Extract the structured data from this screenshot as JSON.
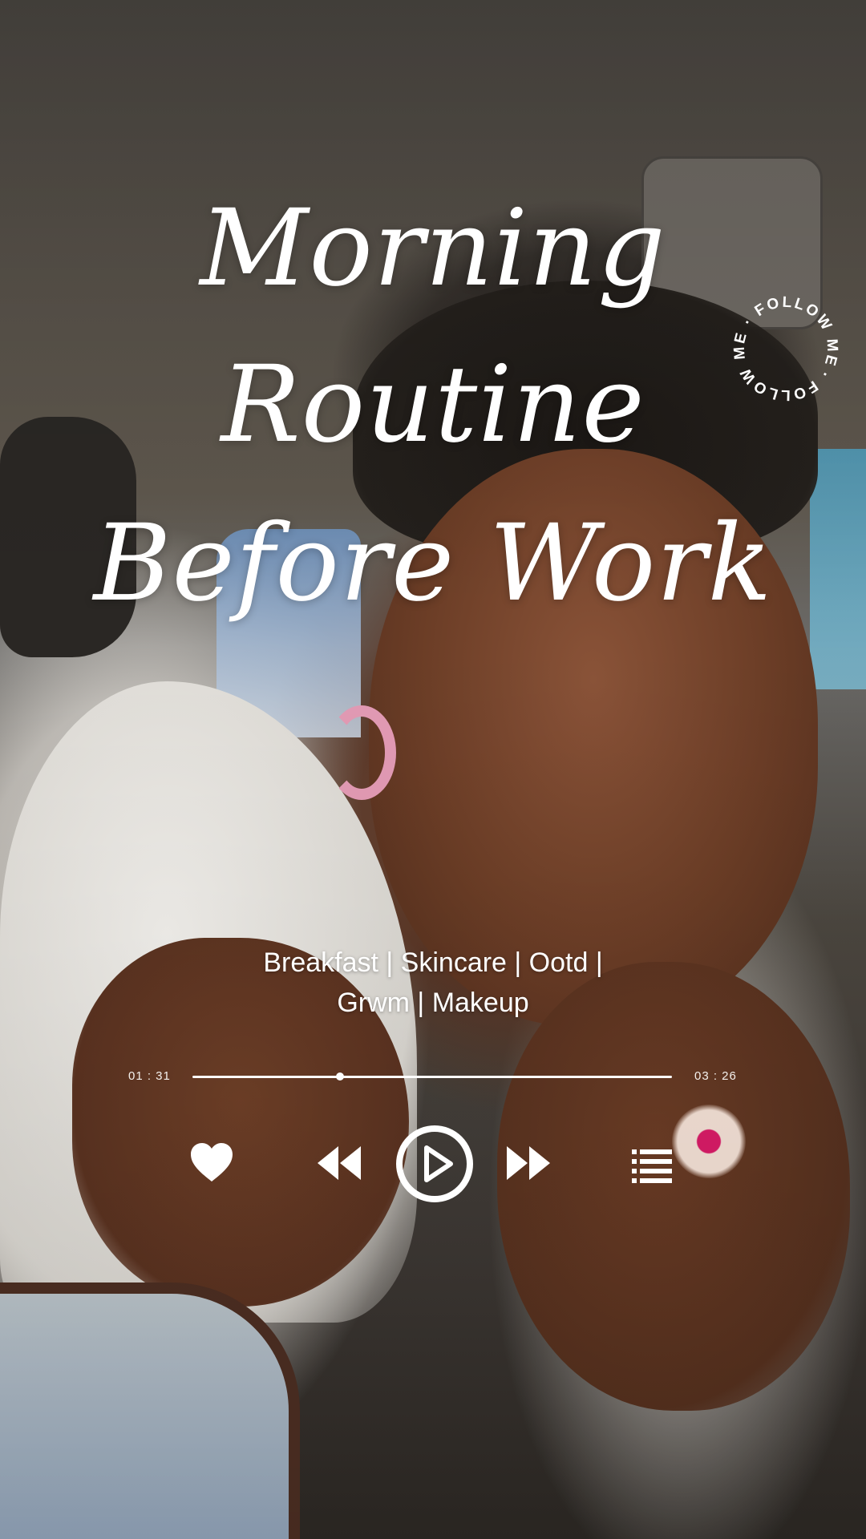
{
  "title": {
    "line1": "Morning",
    "line2": "Routine",
    "line3": "Before Work"
  },
  "badge": {
    "text": "· FOLLOW ME · FOLLOW ME "
  },
  "tags": {
    "line1": "Breakfast | Skincare | Ootd |",
    "line2": "Grwm | Makeup"
  },
  "player": {
    "current_time": "01 : 31",
    "total_time": "03 : 26",
    "progress_fraction": 0.307,
    "controls": {
      "like_icon": "heart-icon",
      "rewind_icon": "rewind-icon",
      "play_icon": "play-icon",
      "forward_icon": "fast-forward-icon",
      "playlist_icon": "playlist-icon"
    }
  },
  "colors": {
    "text": "#ffffff",
    "accent": "#ffffff"
  }
}
